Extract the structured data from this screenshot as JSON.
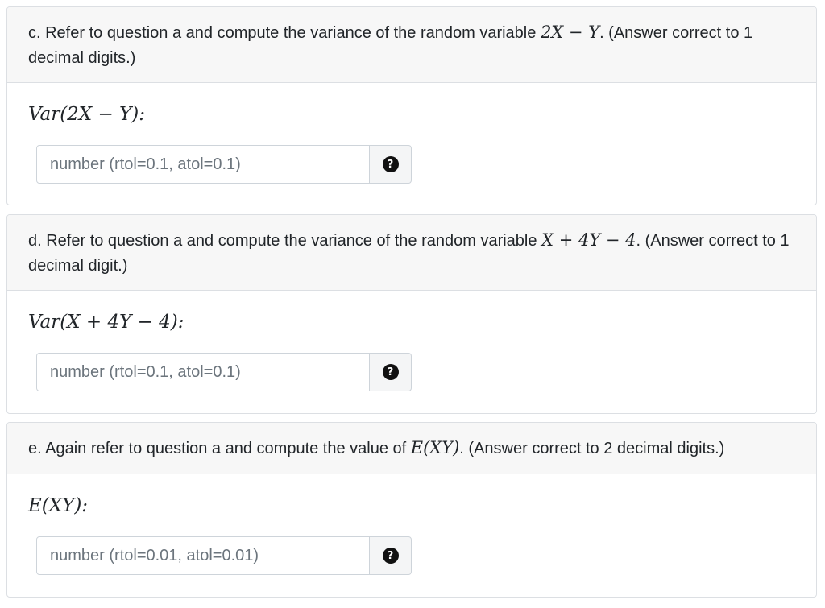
{
  "questions": [
    {
      "prompt_before": "c. Refer to question a and compute the variance of the random variable ",
      "prompt_math": "2X − Y",
      "prompt_after": ". (Answer correct to 1 decimal digits.)",
      "answer_label": "Var(2X − Y):",
      "input_placeholder": "number (rtol=0.1, atol=0.1)",
      "input_value": "",
      "help_icon": "question-circle-icon",
      "help_symbol": "?"
    },
    {
      "prompt_before": "d. Refer to question a and compute the variance of the random variable ",
      "prompt_math": "X + 4Y − 4",
      "prompt_after": ". (Answer correct to 1 decimal digit.)",
      "answer_label": "Var(X + 4Y − 4):",
      "input_placeholder": "number (rtol=0.1, atol=0.1)",
      "input_value": "",
      "help_icon": "question-circle-icon",
      "help_symbol": "?"
    },
    {
      "prompt_before": "e. Again refer to question a and compute the value of ",
      "prompt_math": "E(XY)",
      "prompt_after": ". (Answer correct to 2 decimal digits.)",
      "answer_label": "E(XY):",
      "input_placeholder": "number (rtol=0.01, atol=0.01)",
      "input_value": "",
      "help_icon": "question-circle-icon",
      "help_symbol": "?"
    }
  ],
  "colors": {
    "header_bg": "#f7f7f7",
    "border": "#dcdfe3",
    "text": "#212529",
    "placeholder": "#6c757d",
    "help_icon": "#111111"
  }
}
